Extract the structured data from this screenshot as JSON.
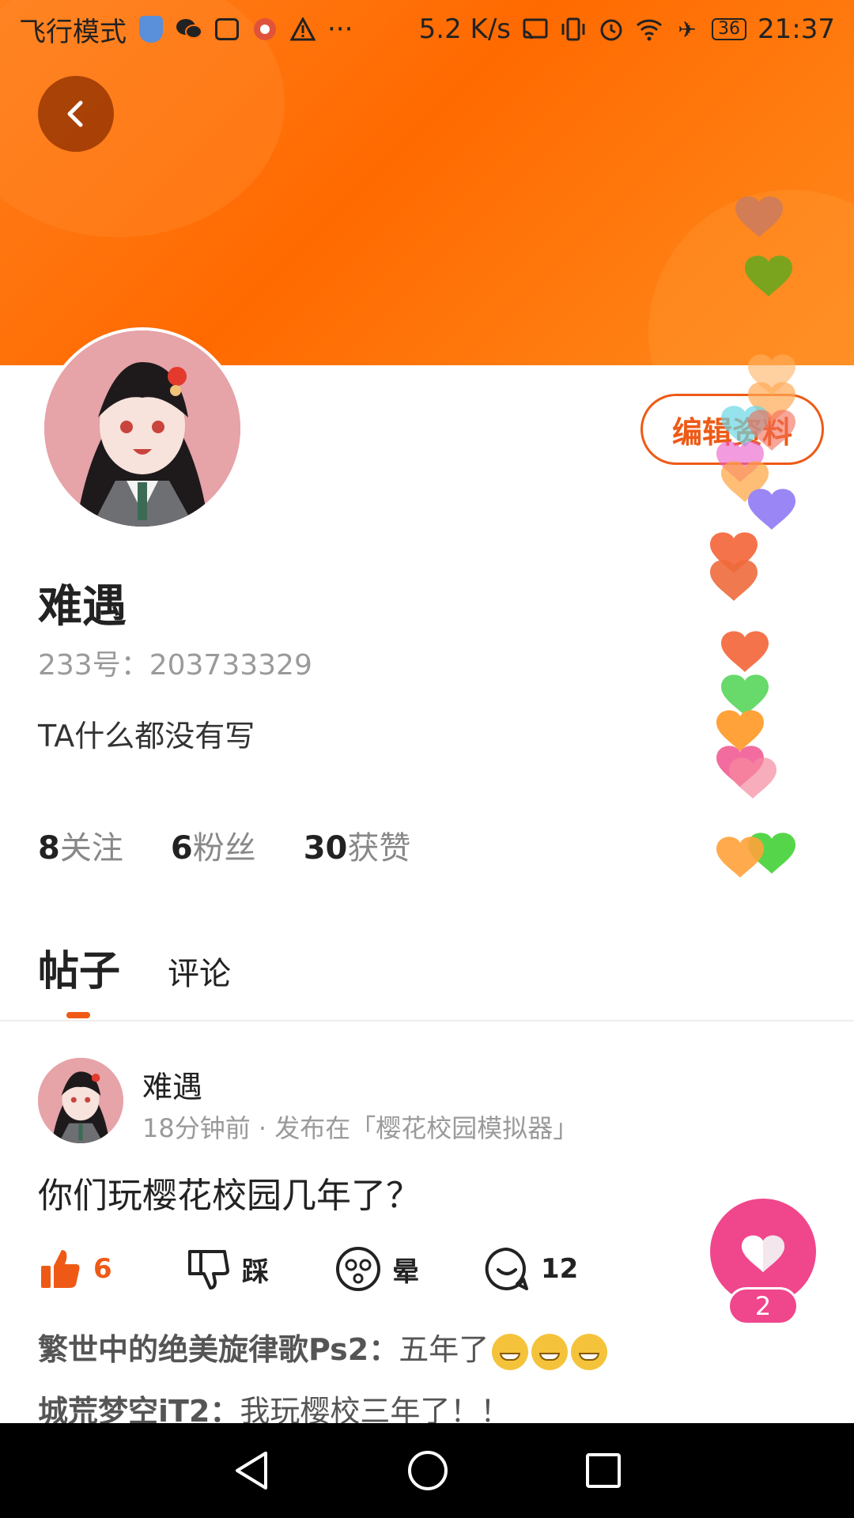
{
  "status_bar": {
    "mode_text": "飞行模式",
    "more": "···",
    "speed": "5.2 K/s",
    "battery": "36",
    "time": "21:37"
  },
  "profile": {
    "edit_label": "编辑资料",
    "nickname": "难遇",
    "account": "233号：203733329",
    "bio": "TA什么都没有写",
    "stats": [
      {
        "num": "8",
        "label": "关注"
      },
      {
        "num": "6",
        "label": "粉丝"
      },
      {
        "num": "30",
        "label": "获赞"
      }
    ]
  },
  "tabs": {
    "posts": "帖子",
    "comments": "评论"
  },
  "post": {
    "author": "难遇",
    "meta": "18分钟前 · 发布在「樱花校园模拟器」",
    "text": "你们玩樱花校园几年了？",
    "like_count": "6",
    "dislike_label": "踩",
    "dizzy_label": "晕",
    "comment_count": "12",
    "comments": [
      {
        "author": "繁世中的绝美旋律歌Ps2：",
        "text": "五年了"
      },
      {
        "author": "城荒梦空iT2：",
        "text": "我玩樱校三年了！！"
      }
    ]
  },
  "like_fab": {
    "count": "2"
  },
  "colors": {
    "accent": "#ee5a16",
    "banner": "#ff7412",
    "like_pink": "#f0468c"
  }
}
